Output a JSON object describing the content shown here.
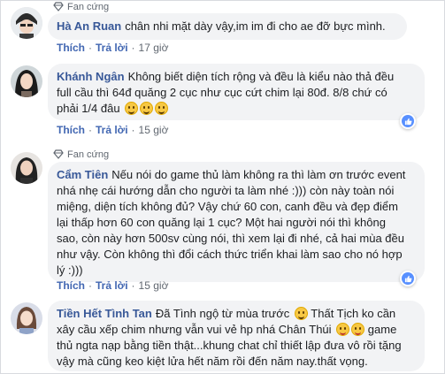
{
  "comments": [
    {
      "badge": "Fan cứng",
      "author": "Hà An Ruan",
      "text": "chân nhi mặt dày vậy,im im đi cho ae đỡ bực mình.",
      "like": "Thích",
      "reply": "Trả lời",
      "time": "17 giờ"
    },
    {
      "badge": "",
      "author": "Khánh Ngân",
      "lines": [
        "Không biết diện tích rộng và đều là kiểu nào thả đều",
        "full cầu thì 64đ quăng 2 cục như cục cứt chim lại 80đ. 8/8 chứ có",
        "phải 1/4 đâu"
      ],
      "like": "Thích",
      "reply": "Trả lời",
      "time": "15 giờ"
    },
    {
      "badge": "Fan cứng",
      "author": "Cẩm Tiên",
      "lines": [
        "Nếu nói do game thủ làm không ra thì làm ơn trước event",
        "nhá nhẹ cái hướng dẫn cho người ta làm nhé :))) còn này toàn nói",
        "miệng, diện tích không đủ? Vậy chứ 60 con, canh đều và đẹp điểm",
        "lại thấp hơn 60 con quăng lại 1 cục? Một hai người nói thì không",
        "sao, còn này hơn 500sv cùng nói, thì xem lại đi nhé, cả hai mùa đều",
        "như vậy. Còn không thì đổi cách thức triển khai làm sao cho nó hợp",
        "lý :)))"
      ],
      "like": "Thích",
      "reply": "Trả lời",
      "time": "15 giờ"
    },
    {
      "badge": "",
      "author": "Tiền Hết Tình Tan",
      "line1": "Đã Tình ngộ từ mùa trước",
      "line1b": "Thất Tịch ko cần",
      "line2a": "xây cầu xếp chim nhưng vẫn vui vẻ hp nhá Chân Thúi",
      "line2b": "game",
      "line3": "thủ ngta nạp bằng tiền thật...khung chat chỉ thiết lập đưa vô rồi tặng",
      "line4": "vậy mà cũng keo kiệt lửa hết năm rồi đến năm nay.thất vọng."
    }
  ],
  "colors": {
    "name": "#385898",
    "bubble": "#f2f3f5",
    "link": "#4267b2",
    "meta": "#606770"
  },
  "icons": [
    "diamond-icon",
    "smile-emoji-icon",
    "like-reaction-icon"
  ]
}
